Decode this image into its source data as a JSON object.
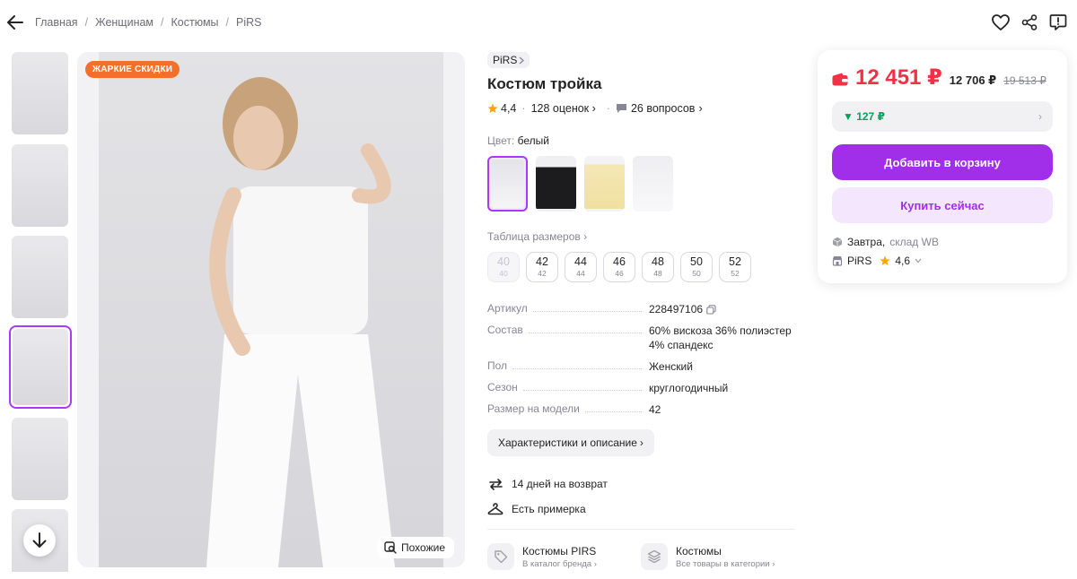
{
  "header": {
    "breadcrumbs": [
      "Главная",
      "Женщинам",
      "Костюмы",
      "PiRS"
    ],
    "back_icon": "arrow-left-icon",
    "actions": [
      "heart-icon",
      "share-icon",
      "report-icon"
    ]
  },
  "gallery": {
    "thumbnails_count": 6,
    "active_thumbnail_index": 3,
    "badge": "ЖАРКИЕ СКИДКИ",
    "similar_button": "Похожие"
  },
  "product": {
    "brand": "PiRS",
    "title": "Костюм тройка",
    "rating": "4,4",
    "reviews": "128 оценок",
    "questions": "26 вопросов",
    "color_label": "Цвет:",
    "color_value": "белый",
    "swatches": [
      "white",
      "black",
      "yellow",
      "light-white"
    ],
    "size_table_label": "Таблица размеров",
    "sizes": [
      {
        "ru": "40",
        "alt": "40",
        "available": false
      },
      {
        "ru": "42",
        "alt": "42",
        "available": true
      },
      {
        "ru": "44",
        "alt": "44",
        "available": true
      },
      {
        "ru": "46",
        "alt": "46",
        "available": true
      },
      {
        "ru": "48",
        "alt": "48",
        "available": true
      },
      {
        "ru": "50",
        "alt": "50",
        "available": true
      },
      {
        "ru": "52",
        "alt": "52",
        "available": true
      }
    ],
    "specs": [
      {
        "key": "Артикул",
        "value": "228497106"
      },
      {
        "key": "Состав",
        "value": "60% вискоза 36% полиэстер 4% спандекс"
      },
      {
        "key": "Пол",
        "value": "Женский"
      },
      {
        "key": "Сезон",
        "value": "круглогодичный"
      },
      {
        "key": "Размер на модели",
        "value": "42"
      }
    ],
    "characteristics_button": "Характеристики и описание",
    "features": [
      "14 дней на возврат",
      "Есть примерка"
    ],
    "catalog_links": [
      {
        "title": "Костюмы PIRS",
        "subtitle": "В каталог бренда"
      },
      {
        "title": "Костюмы",
        "subtitle": "Все товары в категории"
      }
    ]
  },
  "price": {
    "main": "12 451 ₽",
    "wallet": "12 706 ₽",
    "old": "19 513 ₽",
    "cashback": "▼ 127 ₽",
    "add_to_cart": "Добавить в корзину",
    "buy_now": "Купить сейчас",
    "delivery": "Завтра,",
    "warehouse": "склад WB",
    "seller": "PiRS",
    "seller_rating": "4,6",
    "colors": {
      "price": "#f03246",
      "accent": "#a12ee8",
      "cashback": "#00a35b"
    }
  }
}
